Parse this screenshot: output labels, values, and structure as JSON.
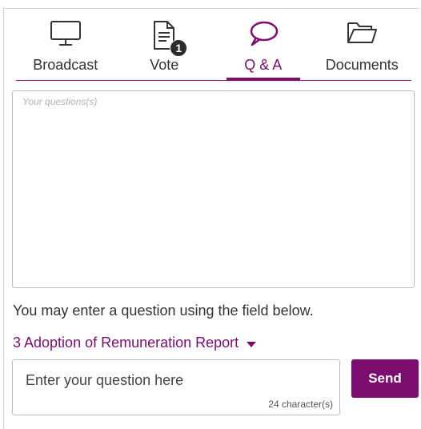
{
  "tabs": [
    {
      "label": "Broadcast",
      "icon": "monitor-icon",
      "active": false
    },
    {
      "label": "Vote",
      "icon": "document-icon",
      "active": false,
      "badge": "1"
    },
    {
      "label": "Q & A",
      "icon": "speech-bubble-icon",
      "active": true
    },
    {
      "label": "Documents",
      "icon": "folder-icon",
      "active": false
    }
  ],
  "questions": {
    "placeholder": "Your questions(s)"
  },
  "info_text": "You may enter a question using the field below.",
  "topic": {
    "label": "3 Adoption of Remuneration Report"
  },
  "question_input": {
    "placeholder": "Enter your question here",
    "value": "",
    "counter": "24 character(s)"
  },
  "send_label": "Send",
  "colors": {
    "accent": "#7c0c6e",
    "icon_dark": "#333333"
  }
}
